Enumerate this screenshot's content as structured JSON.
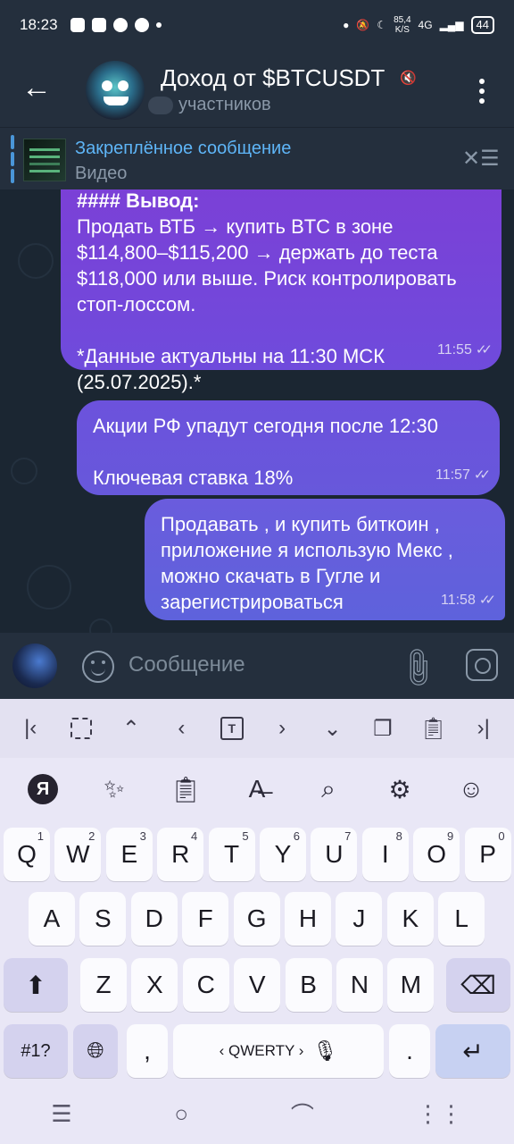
{
  "status_bar": {
    "time": "18:23",
    "net_speed_value": "85,4",
    "net_speed_unit": "K/S",
    "network": "4G",
    "battery": "44"
  },
  "header": {
    "title": "Доход от $BTCUSDT",
    "subtitle": "участников",
    "back_icon": "arrow-left-icon",
    "mute_icon": "muted-speaker-icon",
    "menu_icon": "more-vertical-icon"
  },
  "pinned": {
    "title": "Закреплённое сообщение",
    "subtitle": "Видео"
  },
  "messages": [
    {
      "text": "#### Вывод:\nПродать ВТБ → купить BTC в зоне $114,800–$115,200 → держать до теста $118,000 или выше. Риск контролировать стоп-лоссом.\n\n*Данные актуальны на 11:30 МСК (25.07.2025).*",
      "time": "11:55"
    },
    {
      "text": "Акции РФ упадут сегодня после 12:30\n\nКлючевая ставка 18%",
      "time": "11:57"
    },
    {
      "text": "Продавать , и купить биткоин , приложение я использую Мекс , можно скачать в Гугле и зарегистрироваться",
      "time": "11:58"
    }
  ],
  "input": {
    "placeholder": "Сообщение"
  },
  "keyboard": {
    "row1": [
      {
        "label": "Q",
        "sup": "1"
      },
      {
        "label": "W",
        "sup": "2"
      },
      {
        "label": "E",
        "sup": "3"
      },
      {
        "label": "R",
        "sup": "4"
      },
      {
        "label": "T",
        "sup": "5"
      },
      {
        "label": "Y",
        "sup": "6"
      },
      {
        "label": "U",
        "sup": "7"
      },
      {
        "label": "I",
        "sup": "8"
      },
      {
        "label": "O",
        "sup": "9"
      },
      {
        "label": "P",
        "sup": "0"
      }
    ],
    "row2": [
      "A",
      "S",
      "D",
      "F",
      "G",
      "H",
      "J",
      "K",
      "L"
    ],
    "row3": [
      "Z",
      "X",
      "C",
      "V",
      "B",
      "N",
      "M"
    ],
    "symbols_label": "#1?",
    "comma_label": ",",
    "space_label": "‹ QWERTY ›",
    "period_label": ".",
    "ya_logo": "Я"
  },
  "colors": {
    "accent": "#5eb5f7",
    "bubble_top": "#7c3fd6",
    "bubble_bottom": "#5e62dc",
    "header_bg": "#242f3d"
  }
}
